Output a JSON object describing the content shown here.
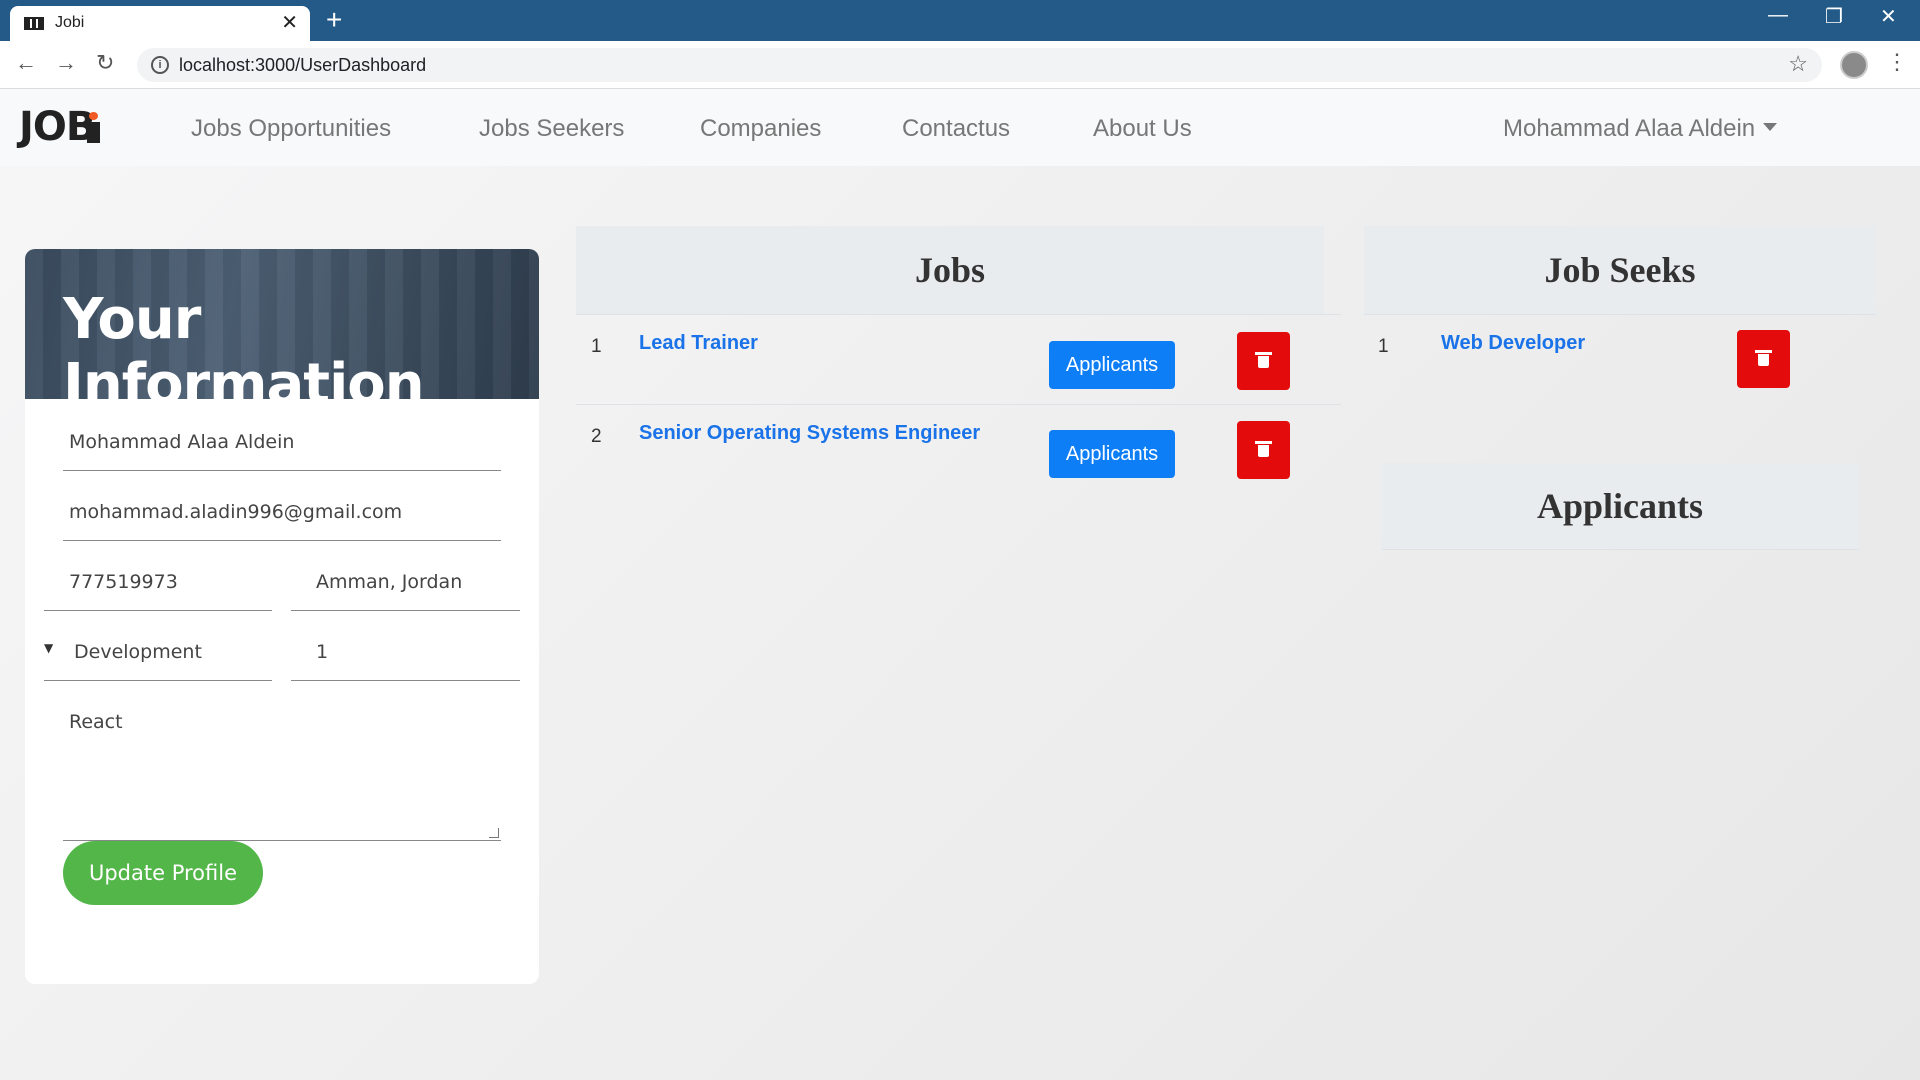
{
  "browser": {
    "tab_title": "Jobi",
    "url": "localhost:3000/UserDashboard"
  },
  "navbar": {
    "logo": "JOB",
    "links": [
      "Jobs Opportunities",
      "Jobs Seekers",
      "Companies",
      "Contactus",
      "About Us"
    ],
    "user": "Mohammad Alaa Aldein"
  },
  "info": {
    "title": "Your Information",
    "name": "Mohammad Alaa Aldein",
    "email": "mohammad.aladin996@gmail.com",
    "phone": "777519973",
    "location": "Amman, Jordan",
    "category": "Development",
    "experience": "1",
    "skills": "React",
    "update_label": "Update Profile"
  },
  "jobs": {
    "title": "Jobs",
    "rows": [
      {
        "num": "1",
        "title": "Lead Trainer",
        "button": "Applicants"
      },
      {
        "num": "2",
        "title": "Senior Operating Systems Engineer",
        "button": "Applicants"
      }
    ]
  },
  "job_seeks": {
    "title": "Job Seeks",
    "rows": [
      {
        "num": "1",
        "title": "Web Developer"
      }
    ]
  },
  "applicants": {
    "title": "Applicants"
  },
  "colors": {
    "tabbar": "#235a87",
    "accent_blue": "#0d7ef5",
    "danger_red": "#e30b0b",
    "success_green": "#53b649",
    "link_blue": "#1a73e8"
  }
}
